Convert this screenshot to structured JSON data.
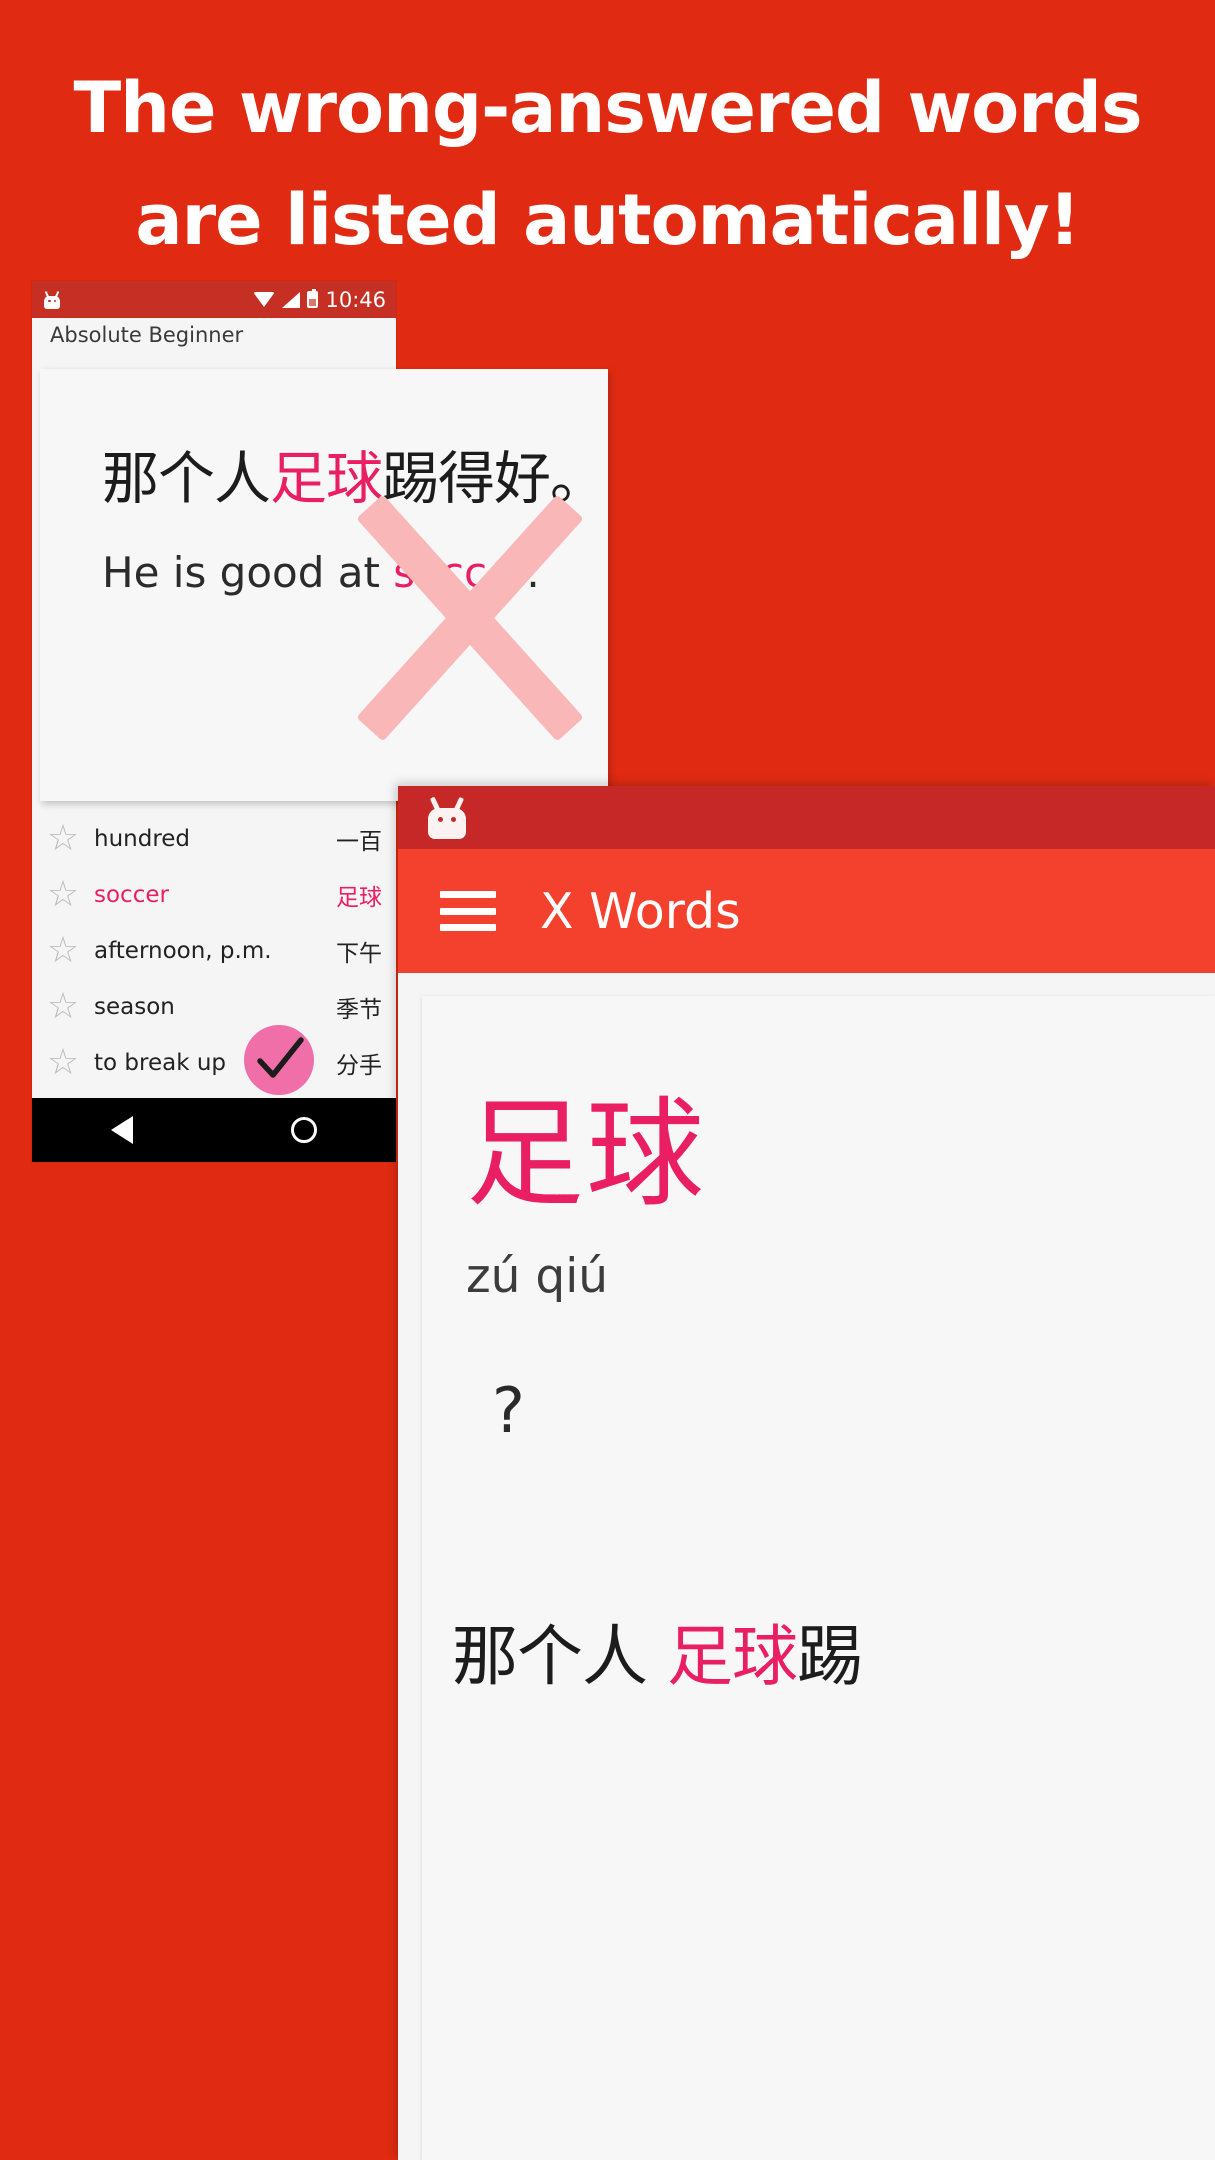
{
  "headline": {
    "line1": "The wrong-answered words",
    "line2": "are listed automatically!"
  },
  "colors": {
    "background_red": "#E02B12",
    "accent_pink": "#E91E63",
    "appbar_red": "#F4412D",
    "statusbar_dark_red": "#C62828",
    "check_badge_pink": "#F06FA8",
    "x_mark_pink": "#FAB7B7"
  },
  "phone1": {
    "status_bar": {
      "time": "10:46",
      "icons": [
        "android-robot-icon",
        "wifi-icon",
        "signal-icon",
        "battery-charging-icon"
      ]
    },
    "screen_title": "Absolute Beginner",
    "card": {
      "sentence_cn_before": "那个人",
      "sentence_cn_highlight": "足球",
      "sentence_cn_after": "踢得好。",
      "sentence_en_before": "He is good at ",
      "sentence_en_highlight": "soccer",
      "sentence_en_after": "."
    },
    "word_list": [
      {
        "star": "☆",
        "english": "hundred",
        "chinese": "一百",
        "highlighted": false
      },
      {
        "star": "☆",
        "english": "soccer",
        "chinese": "足球",
        "highlighted": true
      },
      {
        "star": "☆",
        "english": "afternoon, p.m.",
        "chinese": "下午",
        "highlighted": false
      },
      {
        "star": "☆",
        "english": "season",
        "chinese": "季节",
        "highlighted": false
      },
      {
        "star": "☆",
        "english": "to break up",
        "chinese": "分手",
        "highlighted": false
      }
    ],
    "nav_bar": {
      "back": "back-triangle-icon",
      "home": "home-circle-icon"
    }
  },
  "phone2": {
    "status_bar": {
      "icons": [
        "android-robot-icon"
      ]
    },
    "app_bar": {
      "menu": "hamburger-menu-icon",
      "title": "X Words"
    },
    "card": {
      "word": "足球",
      "pinyin": "zú qiú",
      "question": "?",
      "sentence_cn_before": "那个人 ",
      "sentence_cn_highlight": "足球",
      "sentence_cn_after": "踢"
    }
  }
}
